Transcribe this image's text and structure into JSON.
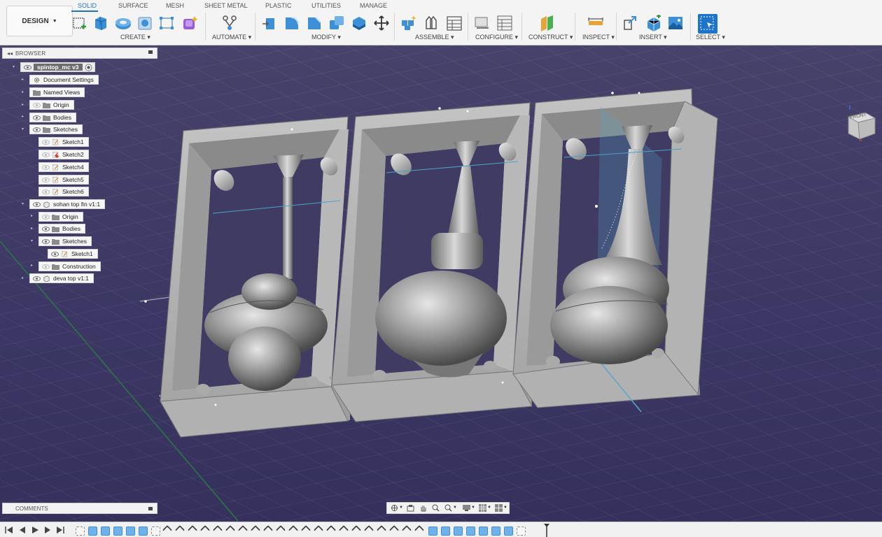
{
  "workspace": {
    "label": "DESIGN"
  },
  "tabs": [
    {
      "label": "SOLID",
      "active": true
    },
    {
      "label": "SURFACE"
    },
    {
      "label": "MESH"
    },
    {
      "label": "SHEET METAL"
    },
    {
      "label": "PLASTIC"
    },
    {
      "label": "UTILITIES"
    },
    {
      "label": "MANAGE"
    }
  ],
  "toolbar_groups": {
    "create": "CREATE ▾",
    "automate": "AUTOMATE ▾",
    "modify": "MODIFY ▾",
    "assemble": "ASSEMBLE ▾",
    "configure": "CONFIGURE ▾",
    "construct": "CONSTRUCT ▾",
    "inspect": "INSPECT ▾",
    "insert": "INSERT ▾",
    "select": "SELECT ▾"
  },
  "toolbar_icons": {
    "create": [
      "new-sketch-icon",
      "extrude-icon",
      "revolve-icon",
      "hole-icon",
      "rectangle-pattern-icon",
      "form-icon"
    ],
    "automate": [
      "automate-icon"
    ],
    "modify": [
      "press-pull-icon",
      "fillet-icon",
      "chamfer-icon",
      "combine-icon",
      "shell-icon",
      "move-icon"
    ],
    "assemble": [
      "new-component-icon",
      "joint-icon",
      "as-built-joint-icon"
    ],
    "configure": [
      "configure-table-icon",
      "configure-grid-icon"
    ],
    "construct": [
      "offset-plane-icon"
    ],
    "inspect": [
      "measure-icon"
    ],
    "insert": [
      "insert-derive-icon",
      "insert-mesh-icon",
      "canvas-icon"
    ],
    "select": [
      "select-icon"
    ]
  },
  "browser": {
    "title": "BROWSER",
    "root": "spintop_mc v3",
    "items": [
      {
        "label": "Document Settings",
        "icon": "gear-icon"
      },
      {
        "label": "Named Views",
        "icon": "folder-icon"
      },
      {
        "label": "Origin",
        "icon": "folder-icon"
      },
      {
        "label": "Bodies",
        "icon": "folder-icon"
      },
      {
        "label": "Sketches",
        "icon": "folder-icon"
      },
      {
        "label": "Sketch1",
        "icon": "sketch-icon"
      },
      {
        "label": "Sketch2",
        "icon": "sketch-error-icon"
      },
      {
        "label": "Sketch4",
        "icon": "sketch-icon"
      },
      {
        "label": "Sketch5",
        "icon": "sketch-icon"
      },
      {
        "label": "Sketch6",
        "icon": "sketch-icon"
      },
      {
        "label": "sohan top fin v1:1",
        "icon": "component-icon"
      },
      {
        "label": "Origin",
        "icon": "folder-icon"
      },
      {
        "label": "Bodies",
        "icon": "folder-icon"
      },
      {
        "label": "Sketches",
        "icon": "folder-icon"
      },
      {
        "label": "Sketch1",
        "icon": "sketch-icon"
      },
      {
        "label": "Construction",
        "icon": "folder-icon"
      },
      {
        "label": "deva top v1:1",
        "icon": "component-icon"
      }
    ]
  },
  "comments": {
    "title": "COMMENTS"
  },
  "viewcube": {
    "label": "FRONT"
  },
  "navbar_icons": [
    "orbit-icon",
    "look-at-icon",
    "pan-icon",
    "zoom-icon",
    "zoom-window-icon",
    "display-settings-icon",
    "grid-icon",
    "viewports-icon"
  ],
  "timeline_controls": [
    "rewind-icon",
    "step-back-icon",
    "play-icon",
    "step-forward-icon",
    "fast-forward-icon"
  ],
  "colors": {
    "accent": "#1e74c8",
    "viewport": "#3c3764",
    "panel": "#f2f2f2",
    "part": "#b4b4b4"
  }
}
